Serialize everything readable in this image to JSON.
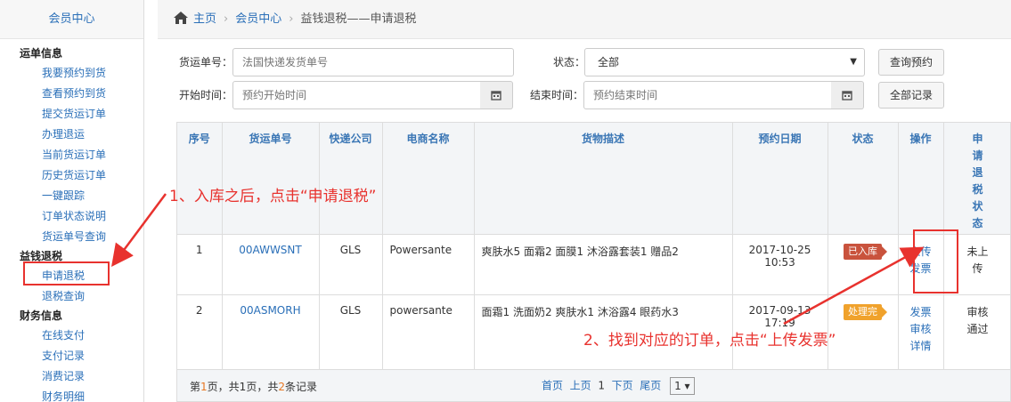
{
  "sidebar": {
    "header": "会员中心",
    "groups": [
      {
        "title": "运单信息",
        "items": [
          "我要预约到货",
          "查看预约到货",
          "提交货运订单",
          "办理退运",
          "当前货运订单",
          "历史货运订单",
          "一键跟踪",
          "订单状态说明",
          "货运单号查询"
        ]
      },
      {
        "title": "益钱退税",
        "items": [
          "申请退税",
          "退税查询"
        ]
      },
      {
        "title": "财务信息",
        "items": [
          "在线支付",
          "支付记录",
          "消费记录",
          "财务明细"
        ]
      }
    ]
  },
  "breadcrumb": {
    "home": "主页",
    "member": "会员中心",
    "current": "益钱退税——申请退税"
  },
  "filters": {
    "waybill_label": "货运单号：",
    "waybill_placeholder": "法国快递发货单号",
    "status_label": "状态：",
    "status_value": "全部",
    "start_label": "开始时间：",
    "start_placeholder": "预约开始时间",
    "end_label": "结束时间：",
    "end_placeholder": "预约结束时间",
    "query_btn": "查询预约",
    "all_btn": "全部记录"
  },
  "table": {
    "headers": [
      "序号",
      "货运单号",
      "快递公司",
      "电商名称",
      "货物描述",
      "预约日期",
      "状态",
      "操作",
      "申请退税状态"
    ],
    "rows": [
      {
        "no": "1",
        "waybill": "00AWWSNT",
        "courier": "GLS",
        "shop": "Powersante",
        "desc": "爽肤水5 面霜2 面膜1 沐浴露套装1 赠品2",
        "date": "2017-10-25 10:53",
        "status": "已入库",
        "ops": [
          "上传",
          "发票"
        ],
        "tax": "未上传"
      },
      {
        "no": "2",
        "waybill": "00ASMORH",
        "courier": "GLS",
        "shop": "powersante",
        "desc": "面霜1 洗面奶2 爽肤水1 沐浴露4 眼药水3",
        "date": "2017-09-13 17:19",
        "status": "处理完",
        "ops": [
          "发票",
          "审核",
          "详情"
        ],
        "tax": "审核通过"
      }
    ]
  },
  "pager": {
    "p1": "第",
    "cur": "1",
    "p2": "页，共",
    "pages": "1",
    "p3": "页，共",
    "total": "2",
    "p4": "条记录",
    "first": "首页",
    "prev": "上页",
    "current": "1",
    "next": "下页",
    "last": "尾页",
    "select": "1 ▾"
  },
  "annotations": {
    "step1": "1、入库之后，点击“申请退税”",
    "step2": "2、找到对应的订单，点击“上传发票”"
  },
  "colors": {
    "accent": "#2a6fb8",
    "annotation": "#e8322e"
  }
}
